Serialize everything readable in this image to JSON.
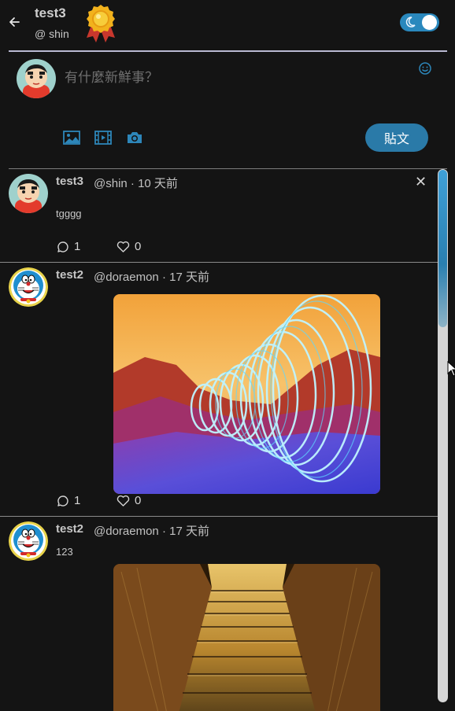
{
  "header": {
    "back_icon": "arrow-left-icon",
    "name": "test3",
    "handle": "@ shin",
    "badge_icon": "medal-icon",
    "theme_toggle_icon": "moon-icon"
  },
  "composer": {
    "placeholder": "有什麼新鮮事？",
    "emoji_icon": "smiley-icon",
    "tools": [
      "image-icon",
      "video-icon",
      "camera-icon"
    ],
    "post_label": "貼文"
  },
  "posts": [
    {
      "name": "test3",
      "meta": "@shin · 10 天前",
      "body": "tgggg",
      "replies": "1",
      "likes": "0",
      "closable": true
    },
    {
      "name": "test2",
      "meta": "@doraemon · 17 天前",
      "body": "",
      "replies": "1",
      "likes": "0",
      "image": "neon-light-spiral-in-desert"
    },
    {
      "name": "test2",
      "meta": "@doraemon · 17 天前",
      "body": "123",
      "image": "golden-stone-stairway"
    }
  ],
  "colors": {
    "background": "#141414",
    "accent": "#2a7aa8",
    "toggle": "#2a88bd"
  }
}
